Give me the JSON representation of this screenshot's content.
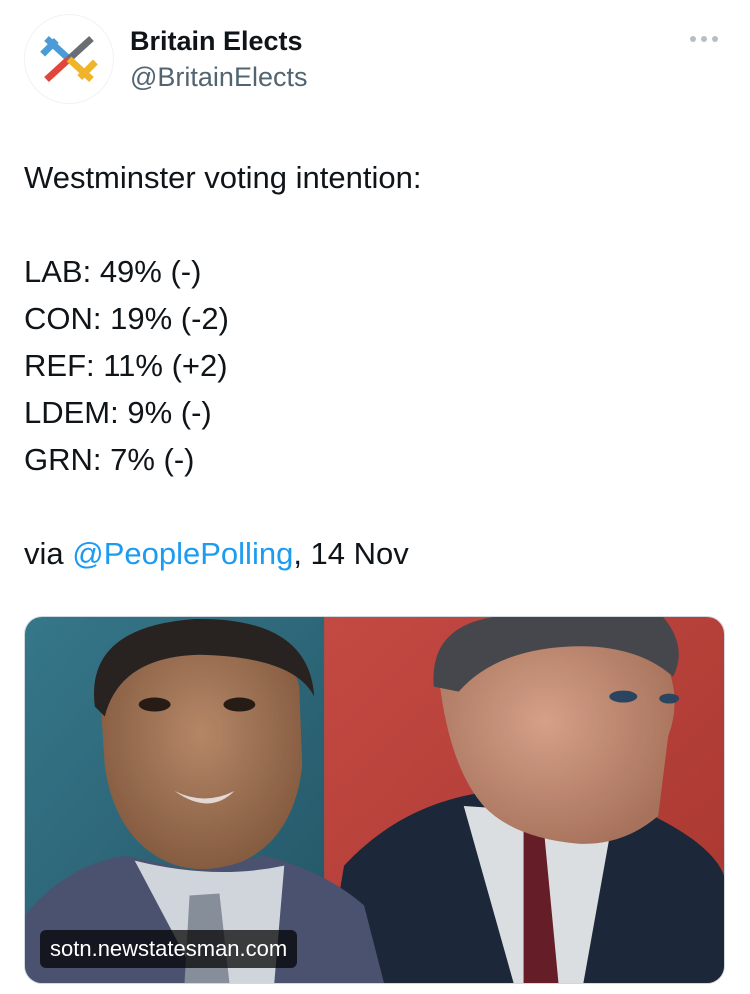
{
  "author": {
    "display_name": "Britain Elects",
    "handle": "@BritainElects",
    "avatar_icon": "britain-elects-x-logo-icon"
  },
  "more_icon": "more-horizontal-icon",
  "tweet": {
    "headline": "Westminster voting intention:",
    "results": [
      "LAB: 49% (-)",
      "CON: 19% (-2)",
      "REF: 11% (+2)",
      "LDEM: 9% (-)",
      "GRN: 7% (-)"
    ],
    "via_prefix": "via ",
    "mention": "@PeoplePolling",
    "date_suffix": ", 14 Nov"
  },
  "link_card": {
    "domain": "sotn.newstatesman.com"
  },
  "colors": {
    "mention": "#1d9bf0",
    "handle": "#536471",
    "text": "#0f1419",
    "media_left_bg": "#2f6f84",
    "media_right_bg": "#c9463f"
  }
}
